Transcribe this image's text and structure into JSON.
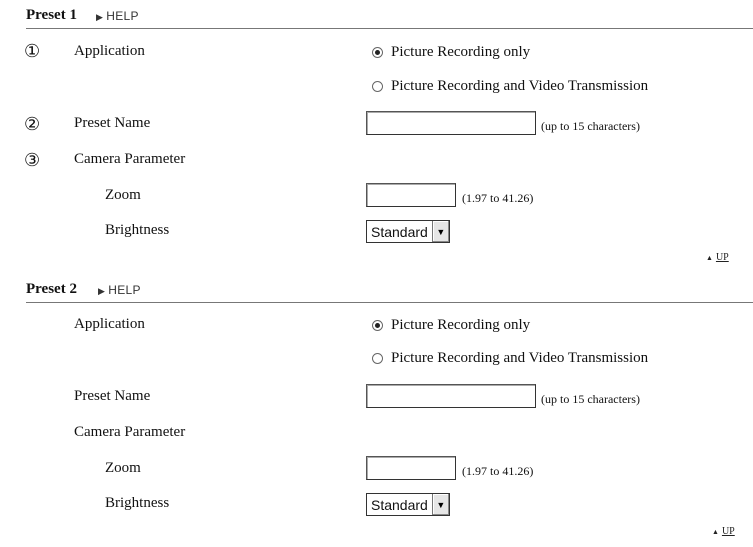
{
  "presets": [
    {
      "title": "Preset 1",
      "help": "HELP",
      "num_application": "①",
      "num_preset_name": "②",
      "num_camera_parameter": "③",
      "application_label": "Application",
      "option1": "Picture Recording only",
      "option2": "Picture Recording and Video Transmission",
      "selected_option": 1,
      "preset_name_label": "Preset Name",
      "preset_name_value": "",
      "preset_name_hint": "(up to 15 characters)",
      "camera_parameter_label": "Camera Parameter",
      "zoom_label": "Zoom",
      "zoom_value": "",
      "zoom_hint": "(1.97 to 41.26)",
      "brightness_label": "Brightness",
      "brightness_value": "Standard",
      "up_label": "UP"
    },
    {
      "title": "Preset 2",
      "help": "HELP",
      "application_label": "Application",
      "option1": "Picture Recording only",
      "option2": "Picture Recording and Video Transmission",
      "selected_option": 1,
      "preset_name_label": "Preset Name",
      "preset_name_value": "",
      "preset_name_hint": "(up to 15 characters)",
      "camera_parameter_label": "Camera Parameter",
      "zoom_label": "Zoom",
      "zoom_value": "",
      "zoom_hint": "(1.97 to 41.26)",
      "brightness_label": "Brightness",
      "brightness_value": "Standard",
      "up_label": "UP"
    }
  ],
  "icons": {
    "help": "triangle-right-icon",
    "dropdown": "triangle-down-icon",
    "up": "triangle-up-icon"
  }
}
